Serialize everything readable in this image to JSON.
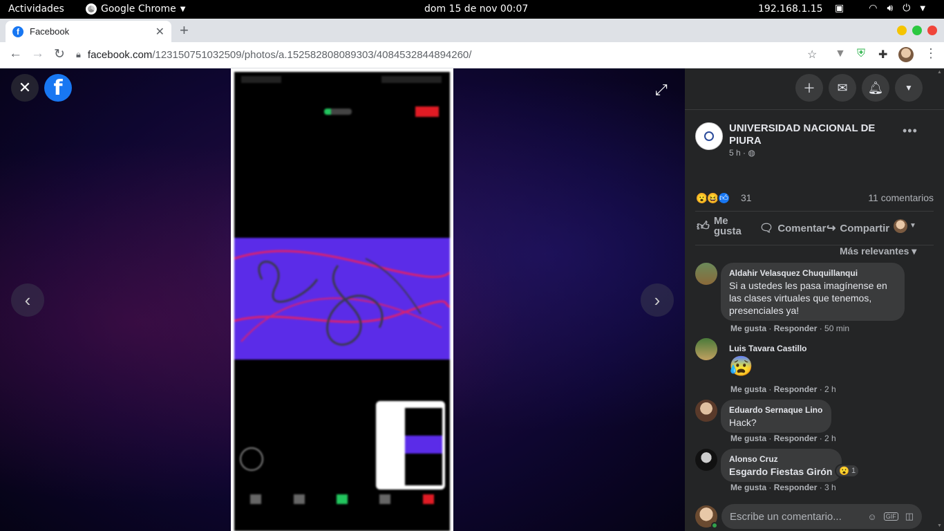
{
  "os": {
    "activities": "Actividades",
    "app_name": "Google Chrome",
    "clock": "dom 15 de nov  00:07",
    "ip": "192.168.1.15"
  },
  "browser": {
    "tab_title": "Facebook",
    "url_host": "facebook.com",
    "url_path": "/123150751032509/photos/a.152582808089303/4084532844894260/"
  },
  "post": {
    "page_name": "UNIVERSIDAD NACIONAL DE PIURA",
    "time": "5 h ·",
    "reaction_count": "31",
    "comments_count": "11 comentarios",
    "like_label": "Me gusta",
    "comment_label": "Comentar",
    "share_label": "Compartir",
    "sort_label": "Más relevantes ▾"
  },
  "comments": [
    {
      "name": "Aldahir Velasquez Chuquillanqui",
      "text": "Si a ustedes les pasa imagínense en las clases virtuales que tenemos, presenciales ya!",
      "like": "Me gusta",
      "reply": "Responder",
      "time": "50 min"
    },
    {
      "name": "Luis Tavara Castillo",
      "text": "😰",
      "like": "Me gusta",
      "reply": "Responder",
      "time": "2 h"
    },
    {
      "name": "Eduardo Sernaque Lino",
      "text": "Hack?",
      "like": "Me gusta",
      "reply": "Responder",
      "time": "2 h"
    },
    {
      "name": "Alonso Cruz",
      "text": "Esgardo Fiestas Girón",
      "reaction_count": "1",
      "like": "Me gusta",
      "reply": "Responder",
      "time": "3 h"
    }
  ],
  "composer": {
    "placeholder": "Escribe un comentario..."
  },
  "colors": {
    "fb_blue": "#1877f2",
    "panel_bg": "#242526",
    "bubble_bg": "#3a3b3c"
  }
}
